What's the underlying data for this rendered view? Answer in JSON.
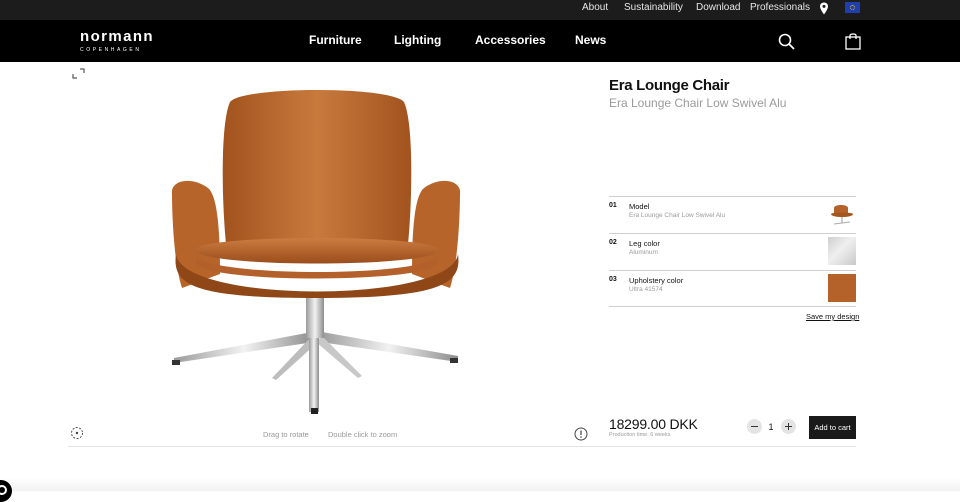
{
  "utility_nav": {
    "links": [
      "About",
      "Sustainability",
      "Download",
      "Professionals"
    ],
    "location_icon": "map-pin-icon",
    "flag_icon": "eu-flag-icon"
  },
  "header": {
    "logo_brand": "normann",
    "logo_sub": "COPENHAGEN",
    "nav": [
      "Furniture",
      "Lighting",
      "Accessories",
      "News"
    ],
    "search_icon": "search-icon",
    "cart_icon": "shopping-bag-icon"
  },
  "viewer": {
    "drag_hint": "Drag to rotate",
    "zoom_hint": "Double click to zoom"
  },
  "product": {
    "title": "Era Lounge Chair",
    "subtitle": "Era Lounge Chair Low Swivel Alu",
    "config": [
      {
        "num": "01",
        "label": "Model",
        "value": "Era Lounge Chair Low Swivel Alu",
        "thumb": "chair"
      },
      {
        "num": "02",
        "label": "Leg color",
        "value": "Aluminum",
        "thumb": "aluminum-swatch"
      },
      {
        "num": "03",
        "label": "Upholstery color",
        "value": "Ultra 41574",
        "thumb": "leather-swatch"
      }
    ],
    "save_label": "Save my design",
    "price": "18299.00 DKK",
    "production_time": "Production time: 6 weeks",
    "quantity": "1",
    "add_to_cart": "Add to cart"
  },
  "colors": {
    "header_bg": "#000000",
    "utility_bg": "#1c1c1c",
    "leather": "#b5622a",
    "button_bg": "#1a1a1a"
  }
}
